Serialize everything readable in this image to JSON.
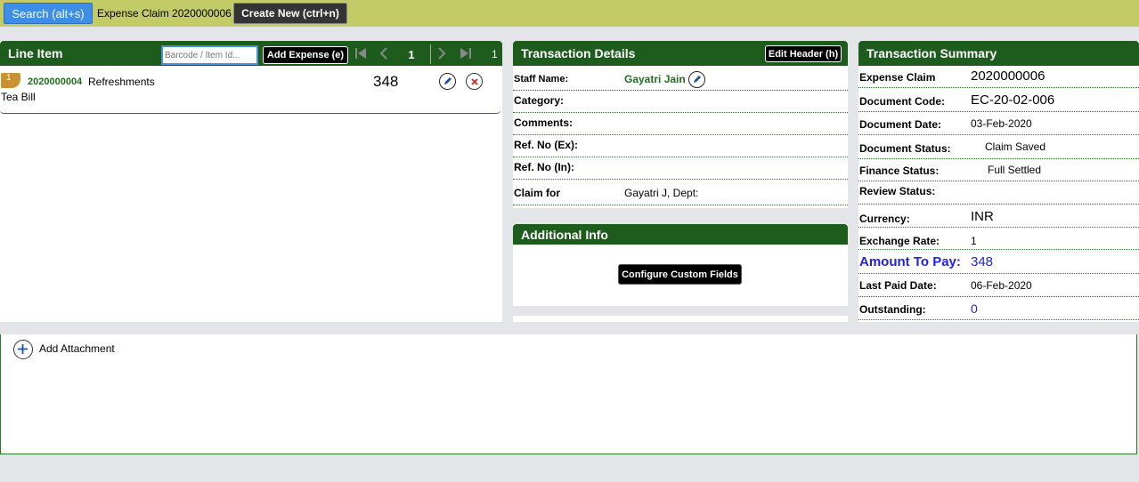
{
  "topbar": {
    "search_label": "Search (alt+s)",
    "doc_type": "Expense Claim",
    "doc_number": "2020000006",
    "create_label": "Create New (ctrl+n)"
  },
  "line_item": {
    "title": "Line Item",
    "barcode_placeholder": "Barcode / Item Id...",
    "add_expense_label": "Add Expense (e)",
    "page": "1",
    "total_pages": "1",
    "items": [
      {
        "index": "1",
        "code": "2020000004",
        "category": "Refreshments",
        "amount": "348",
        "description": "Tea Bill"
      }
    ]
  },
  "transaction_details": {
    "title": "Transaction Details",
    "edit_header_label": "Edit Header (h)",
    "fields": [
      {
        "label": "Staff Name:",
        "value": "Gayatri Jain"
      },
      {
        "label": "Category:",
        "value": ""
      },
      {
        "label": "Comments:",
        "value": ""
      },
      {
        "label": "Ref. No (Ex):",
        "value": ""
      },
      {
        "label": "Ref. No (In):",
        "value": ""
      },
      {
        "label": "Claim for",
        "value": "Gayatri J, Dept:"
      }
    ]
  },
  "additional_info": {
    "title": "Additional Info",
    "configure_label": "Configure Custom Fields"
  },
  "transaction_summary": {
    "title": "Transaction Summary",
    "fields": [
      {
        "label": "Expense Claim",
        "value": "2020000006"
      },
      {
        "label": "Document Code:",
        "value": "EC-20-02-006"
      },
      {
        "label": "Document Date:",
        "value": "03-Feb-2020"
      },
      {
        "label": "Document Status:",
        "value": "Claim Saved"
      },
      {
        "label": "Finance Status:",
        "value": "Full Settled"
      },
      {
        "label": "Review Status:",
        "value": ""
      },
      {
        "label": "Currency:",
        "value": "INR"
      },
      {
        "label": "Exchange Rate:",
        "value": "1"
      },
      {
        "label": "Amount To Pay:",
        "value": "348"
      },
      {
        "label": "Last Paid Date:",
        "value": "06-Feb-2020"
      },
      {
        "label": "Outstanding:",
        "value": "0"
      }
    ]
  },
  "attachments": {
    "add_label": "Add Attachment"
  },
  "colors": {
    "header_green": "#1e5c1e",
    "topbar": "#c3cb66",
    "accent_blue": "#3d8ee8",
    "amount_blue": "#2222dd",
    "code_green": "#1e6e1e"
  }
}
